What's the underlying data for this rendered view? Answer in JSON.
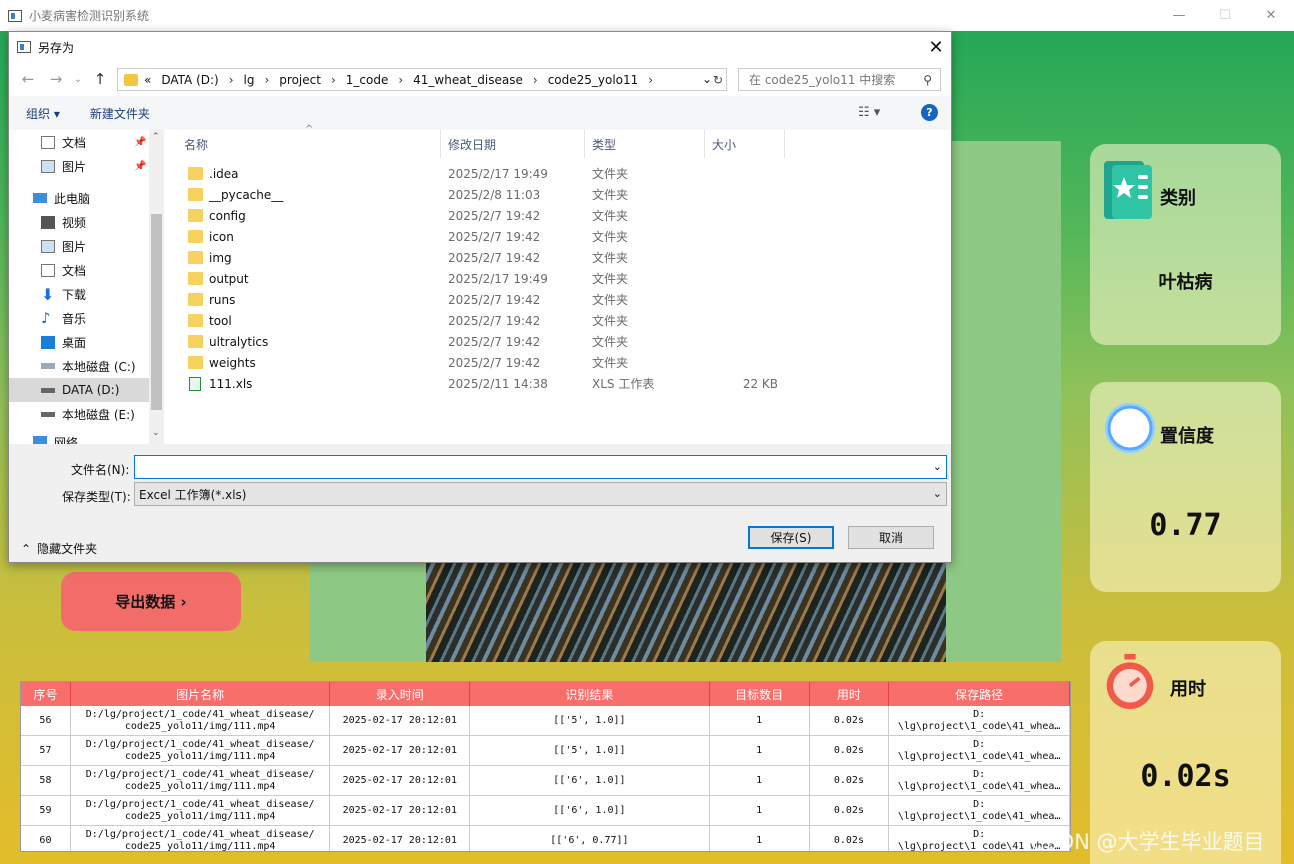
{
  "app": {
    "title": "小麦病害检测识别系统",
    "min": "—",
    "max": "☐",
    "close": "✕"
  },
  "cards": {
    "category": {
      "label": "类别",
      "value": "叶枯病"
    },
    "confidence": {
      "label": "置信度",
      "value": "0.77"
    },
    "time": {
      "label": "用时",
      "value": "0.02s"
    }
  },
  "export_button": {
    "label": "导出数据 ›"
  },
  "table": {
    "headers": [
      "序号",
      "图片名称",
      "录入时间",
      "识别结果",
      "目标数目",
      "用时",
      "保存路径"
    ],
    "rows": [
      {
        "id": "56",
        "name": "D:/lg/project/1_code/41_wheat_disease/ code25_yolo11/img/111.mp4",
        "time": "2025-02-17 20:12:01",
        "result": "[['5', 1.0]]",
        "count": "1",
        "dur": "0.02s",
        "path": "D: \\lg\\project\\1_code\\41_whea…"
      },
      {
        "id": "57",
        "name": "D:/lg/project/1_code/41_wheat_disease/ code25_yolo11/img/111.mp4",
        "time": "2025-02-17 20:12:01",
        "result": "[['5', 1.0]]",
        "count": "1",
        "dur": "0.02s",
        "path": "D: \\lg\\project\\1_code\\41_whea…"
      },
      {
        "id": "58",
        "name": "D:/lg/project/1_code/41_wheat_disease/ code25_yolo11/img/111.mp4",
        "time": "2025-02-17 20:12:01",
        "result": "[['6', 1.0]]",
        "count": "1",
        "dur": "0.02s",
        "path": "D: \\lg\\project\\1_code\\41_whea…"
      },
      {
        "id": "59",
        "name": "D:/lg/project/1_code/41_wheat_disease/ code25_yolo11/img/111.mp4",
        "time": "2025-02-17 20:12:01",
        "result": "[['6', 1.0]]",
        "count": "1",
        "dur": "0.02s",
        "path": "D: \\lg\\project\\1_code\\41_whea…"
      },
      {
        "id": "60",
        "name": "D:/lg/project/1_code/41_wheat_disease/ code25_yolo11/img/111.mp4",
        "time": "2025-02-17 20:12:01",
        "result": "[['6', 0.77]]",
        "count": "1",
        "dur": "0.02s",
        "path": "D: \\lg\\project\\1_code\\41_whea…"
      }
    ]
  },
  "watermark": "CSDN @大学生毕业题目",
  "dialog": {
    "title": "另存为",
    "path": [
      "«",
      "DATA (D:)",
      "lg",
      "project",
      "1_code",
      "41_wheat_disease",
      "code25_yolo11"
    ],
    "search_placeholder": "在 code25_yolo11 中搜索",
    "organize": "组织 ▾",
    "new_folder": "新建文件夹",
    "nav": [
      "文档",
      "图片",
      "此电脑",
      "视频",
      "图片",
      "文档",
      "下载",
      "音乐",
      "桌面",
      "本地磁盘 (C:)",
      "DATA (D:)",
      "本地磁盘 (E:)",
      "网络"
    ],
    "columns": [
      "名称",
      "修改日期",
      "类型",
      "大小"
    ],
    "files": [
      {
        "name": ".idea",
        "date": "2025/2/17 19:49",
        "type": "文件夹",
        "size": ""
      },
      {
        "name": "__pycache__",
        "date": "2025/2/8 11:03",
        "type": "文件夹",
        "size": ""
      },
      {
        "name": "config",
        "date": "2025/2/7 19:42",
        "type": "文件夹",
        "size": ""
      },
      {
        "name": "icon",
        "date": "2025/2/7 19:42",
        "type": "文件夹",
        "size": ""
      },
      {
        "name": "img",
        "date": "2025/2/7 19:42",
        "type": "文件夹",
        "size": ""
      },
      {
        "name": "output",
        "date": "2025/2/17 19:49",
        "type": "文件夹",
        "size": ""
      },
      {
        "name": "runs",
        "date": "2025/2/7 19:42",
        "type": "文件夹",
        "size": ""
      },
      {
        "name": "tool",
        "date": "2025/2/7 19:42",
        "type": "文件夹",
        "size": ""
      },
      {
        "name": "ultralytics",
        "date": "2025/2/7 19:42",
        "type": "文件夹",
        "size": ""
      },
      {
        "name": "weights",
        "date": "2025/2/7 19:42",
        "type": "文件夹",
        "size": ""
      },
      {
        "name": "111.xls",
        "date": "2025/2/11 14:38",
        "type": "XLS 工作表",
        "size": "22 KB"
      }
    ],
    "filename_label": "文件名(N):",
    "filename_value": "",
    "filetype_label": "保存类型(T):",
    "filetype_value": "Excel 工作簿(*.xls)",
    "save": "保存(S)",
    "cancel": "取消",
    "hide_folders": "隐藏文件夹"
  }
}
